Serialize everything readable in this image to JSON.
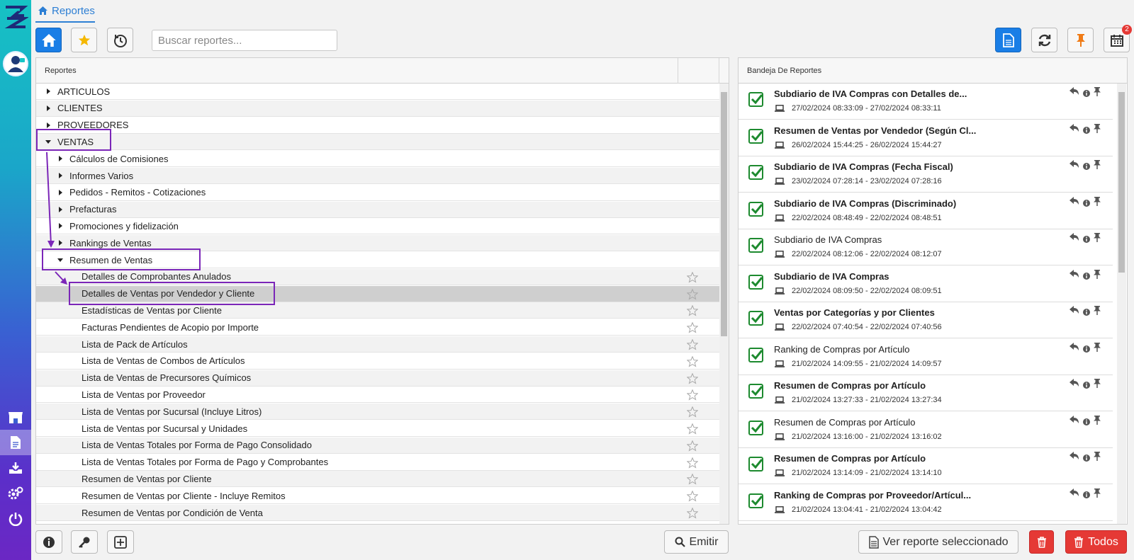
{
  "breadcrumb": {
    "label": "Reportes",
    "icon": "home-icon"
  },
  "toolbar": {
    "search_placeholder": "Buscar reportes...",
    "calendar_badge": "2"
  },
  "left_panel": {
    "header": "Reportes",
    "rows": [
      {
        "label": "ARTICULOS",
        "level": 0,
        "state": "collapsed",
        "star": false
      },
      {
        "label": "CLIENTES",
        "level": 0,
        "state": "collapsed",
        "star": false
      },
      {
        "label": "PROVEEDORES",
        "level": 0,
        "state": "collapsed",
        "star": false
      },
      {
        "label": "VENTAS",
        "level": 0,
        "state": "expanded",
        "star": false
      },
      {
        "label": "Cálculos de Comisiones",
        "level": 1,
        "state": "collapsed",
        "star": false
      },
      {
        "label": "Informes Varios",
        "level": 1,
        "state": "collapsed",
        "star": false
      },
      {
        "label": "Pedidos - Remitos - Cotizaciones",
        "level": 1,
        "state": "collapsed",
        "star": false
      },
      {
        "label": "Prefacturas",
        "level": 1,
        "state": "collapsed",
        "star": false
      },
      {
        "label": "Promociones y fidelización",
        "level": 1,
        "state": "collapsed",
        "star": false
      },
      {
        "label": "Rankings de Ventas",
        "level": 1,
        "state": "collapsed",
        "star": false
      },
      {
        "label": "Resumen de Ventas",
        "level": 1,
        "state": "expanded",
        "star": false
      },
      {
        "label": "Detalles de Comprobantes Anulados",
        "level": 2,
        "state": "leaf",
        "star": true
      },
      {
        "label": "Detalles de Ventas por Vendedor y Cliente",
        "level": 2,
        "state": "leaf",
        "star": true,
        "selected": true
      },
      {
        "label": "Estadísticas de Ventas por Cliente",
        "level": 2,
        "state": "leaf",
        "star": true
      },
      {
        "label": "Facturas Pendientes de Acopio por Importe",
        "level": 2,
        "state": "leaf",
        "star": true
      },
      {
        "label": "Lista de Pack de Artículos",
        "level": 2,
        "state": "leaf",
        "star": true
      },
      {
        "label": "Lista de Ventas de Combos de Artículos",
        "level": 2,
        "state": "leaf",
        "star": true
      },
      {
        "label": "Lista de Ventas de Precursores Químicos",
        "level": 2,
        "state": "leaf",
        "star": true
      },
      {
        "label": "Lista de Ventas por Proveedor",
        "level": 2,
        "state": "leaf",
        "star": true
      },
      {
        "label": "Lista de Ventas por Sucursal (Incluye Litros)",
        "level": 2,
        "state": "leaf",
        "star": true
      },
      {
        "label": "Lista de Ventas por Sucursal y Unidades",
        "level": 2,
        "state": "leaf",
        "star": true
      },
      {
        "label": "Lista de Ventas Totales por Forma de Pago Consolidado",
        "level": 2,
        "state": "leaf",
        "star": true
      },
      {
        "label": "Lista de Ventas Totales por Forma de Pago y Comprobantes",
        "level": 2,
        "state": "leaf",
        "star": true
      },
      {
        "label": "Resumen de Ventas por Cliente",
        "level": 2,
        "state": "leaf",
        "star": true
      },
      {
        "label": "Resumen de Ventas por Cliente - Incluye Remitos",
        "level": 2,
        "state": "leaf",
        "star": true
      },
      {
        "label": "Resumen de Ventas por Condición de Venta",
        "level": 2,
        "state": "leaf",
        "star": true
      }
    ]
  },
  "right_panel": {
    "header": "Bandeja De Reportes",
    "items": [
      {
        "title": "Subdiario de IVA Compras con Detalles de...",
        "bold": true,
        "time": "27/02/2024 08:33:09 - 27/02/2024 08:33:11"
      },
      {
        "title": "Resumen de Ventas por Vendedor (Según Cl...",
        "bold": true,
        "time": "26/02/2024 15:44:25 - 26/02/2024 15:44:27"
      },
      {
        "title": "Subdiario de IVA Compras (Fecha Fiscal)",
        "bold": true,
        "time": "23/02/2024 07:28:14 - 23/02/2024 07:28:16"
      },
      {
        "title": "Subdiario de IVA Compras (Discriminado)",
        "bold": true,
        "time": "22/02/2024 08:48:49 - 22/02/2024 08:48:51"
      },
      {
        "title": "Subdiario de IVA Compras",
        "bold": false,
        "time": "22/02/2024 08:12:06 - 22/02/2024 08:12:07"
      },
      {
        "title": "Subdiario de IVA Compras",
        "bold": true,
        "time": "22/02/2024 08:09:50 - 22/02/2024 08:09:51"
      },
      {
        "title": "Ventas por Categorías y por Clientes",
        "bold": true,
        "time": "22/02/2024 07:40:54 - 22/02/2024 07:40:56"
      },
      {
        "title": "Ranking de Compras por Artículo",
        "bold": false,
        "time": "21/02/2024 14:09:55 - 21/02/2024 14:09:57"
      },
      {
        "title": "Resumen de Compras por Artículo",
        "bold": true,
        "time": "21/02/2024 13:27:33 - 21/02/2024 13:27:34"
      },
      {
        "title": "Resumen de Compras por Artículo",
        "bold": false,
        "time": "21/02/2024 13:16:00 - 21/02/2024 13:16:02"
      },
      {
        "title": "Resumen de Compras por Artículo",
        "bold": true,
        "time": "21/02/2024 13:14:09 - 21/02/2024 13:14:10"
      },
      {
        "title": "Ranking de Compras por Proveedor/Artícul...",
        "bold": true,
        "time": "21/02/2024 13:04:41 - 21/02/2024 13:04:42"
      }
    ]
  },
  "bottom": {
    "emit_label": "Emitir",
    "view_label": "Ver reporte seleccionado",
    "all_label": "Todos"
  },
  "colors": {
    "accent": "#1a7ee6",
    "danger": "#e53935",
    "check": "#1d8a2f",
    "annotation": "#7b26b8"
  }
}
